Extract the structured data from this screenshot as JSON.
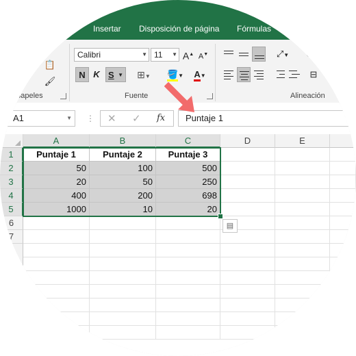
{
  "ribbon": {
    "tabs": [
      "Insertar",
      "Disposición de página",
      "Fórmulas"
    ],
    "font_name": "Calibri",
    "font_size": "11",
    "bold_label": "N",
    "italic_label": "K",
    "underline_label": "S",
    "grow_label": "A",
    "shrink_label": "A",
    "font_color_label": "A",
    "group_clipboard": "apapeles",
    "group_font": "Fuente",
    "group_alignment": "Alineación"
  },
  "formula_bar": {
    "name_box": "A1",
    "fx_label": "fx",
    "content": "Puntaje 1"
  },
  "grid": {
    "columns": [
      "A",
      "B",
      "C",
      "D",
      "E"
    ],
    "rows": [
      "1",
      "2",
      "3",
      "4",
      "5",
      "6",
      "7"
    ],
    "header": [
      "Puntaje 1",
      "Puntaje 2",
      "Puntaje 3"
    ],
    "data": [
      [
        "50",
        "100",
        "500"
      ],
      [
        "20",
        "50",
        "250"
      ],
      [
        "400",
        "200",
        "698"
      ],
      [
        "1000",
        "10",
        "20"
      ]
    ]
  },
  "colors": {
    "excel_green": "#217346",
    "arrow": "#f26b6b"
  }
}
